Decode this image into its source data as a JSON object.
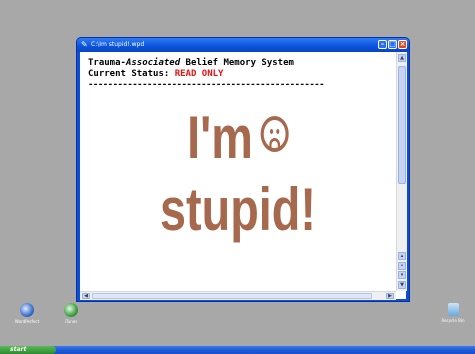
{
  "window": {
    "title": "C:\\Im stupid!.wpd"
  },
  "document": {
    "line1_prefix": "Trauma-",
    "line1_italic": "Associated",
    "line1_suffix": " Belief Memory System",
    "status_label": "Current Status: ",
    "status_value": "READ ONLY",
    "dashes": "------------------------------------------------",
    "big_line1": "I'm",
    "big_line2": "stupid!"
  },
  "desktop_icons": [
    {
      "label": "WordPerfect",
      "icon": "wordperfect-icon"
    },
    {
      "label": "iTunes",
      "icon": "itunes-icon"
    },
    {
      "label": "Recycle Bin",
      "icon": "recycle-bin-icon"
    }
  ],
  "taskbar": {
    "start_label": "start"
  },
  "colors": {
    "desktop": "#a8a8a8",
    "title_bar": "#0a53db",
    "status_value": "#ee1111",
    "big_text": "#a7694d"
  }
}
